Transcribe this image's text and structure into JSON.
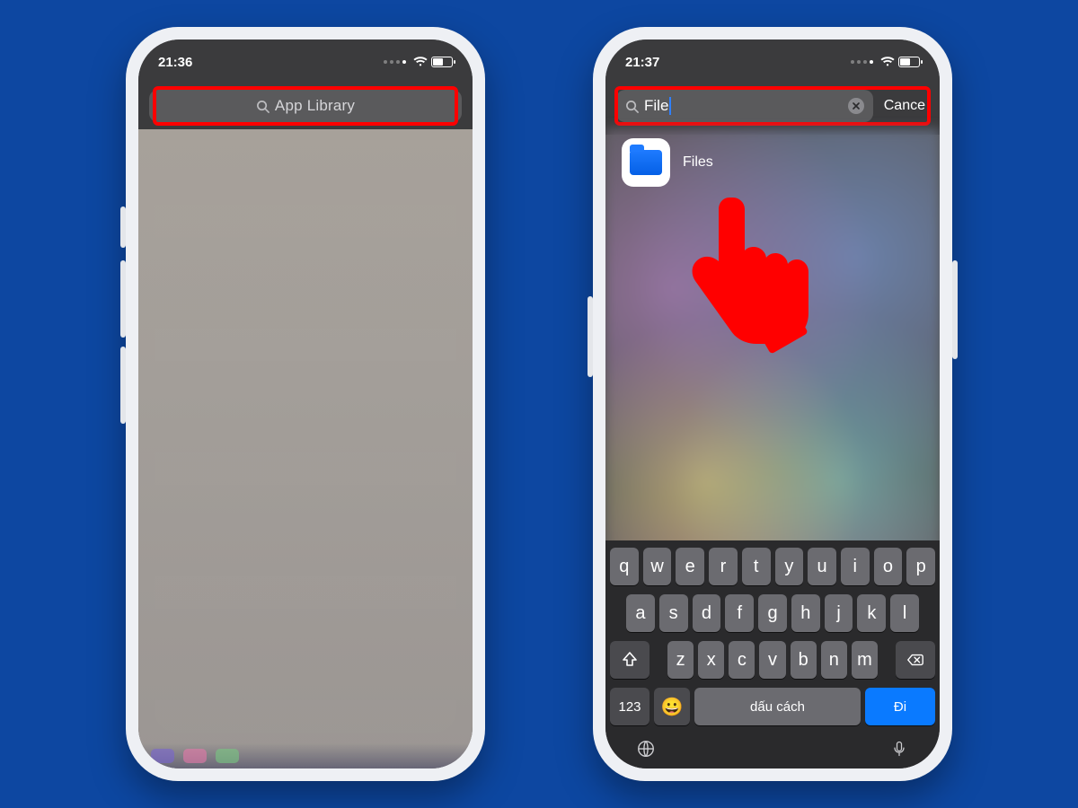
{
  "highlight_color": "#ff0000",
  "left": {
    "time": "21:36",
    "search_placeholder": "App Library"
  },
  "right": {
    "time": "21:37",
    "search_value": "File",
    "cancel_label": "Cance",
    "result_app_name": "Files",
    "keyboard": {
      "row1": [
        "q",
        "w",
        "e",
        "r",
        "t",
        "y",
        "u",
        "i",
        "o",
        "p"
      ],
      "row2": [
        "a",
        "s",
        "d",
        "f",
        "g",
        "h",
        "j",
        "k",
        "l"
      ],
      "row3": [
        "z",
        "x",
        "c",
        "v",
        "b",
        "n",
        "m"
      ],
      "k123": "123",
      "space": "dấu cách",
      "go": "Đi"
    }
  }
}
